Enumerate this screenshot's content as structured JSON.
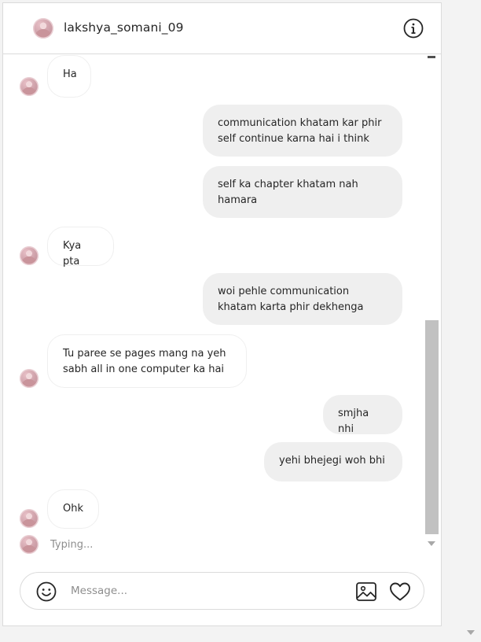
{
  "header": {
    "username": "lakshya_somani_09",
    "avatar_icon": "profile-avatar",
    "info_icon": "info-icon"
  },
  "messages": [
    {
      "side": "received",
      "text": "Ha",
      "avatar": true
    },
    {
      "side": "sent",
      "text": "communication khatam kar phir\nself continue karna hai i think"
    },
    {
      "side": "sent",
      "text": "self ka chapter khatam nah\nhamara"
    },
    {
      "side": "received",
      "text": "Kya pta",
      "avatar": true
    },
    {
      "side": "sent",
      "text": "woi pehle communication\nkhatam karta phir dekhenga"
    },
    {
      "side": "received",
      "text": "Tu paree se pages mang na yeh\nsabh all in one computer ka hai",
      "avatar": true
    },
    {
      "side": "sent",
      "text": "smjha nhi"
    },
    {
      "side": "sent",
      "text": "yehi bhejegi woh bhi"
    },
    {
      "side": "received",
      "text": "Ohk",
      "avatar": true
    }
  ],
  "typing": {
    "text": "Typing..."
  },
  "composer": {
    "placeholder": "Message...",
    "value": "",
    "icons": [
      "emoji-icon",
      "image-icon",
      "heart-icon"
    ]
  },
  "colors": {
    "sent_bubble": "#efefef",
    "received_border": "#efefef",
    "border": "#dbdbdb",
    "muted_text": "#8e8e8e"
  }
}
